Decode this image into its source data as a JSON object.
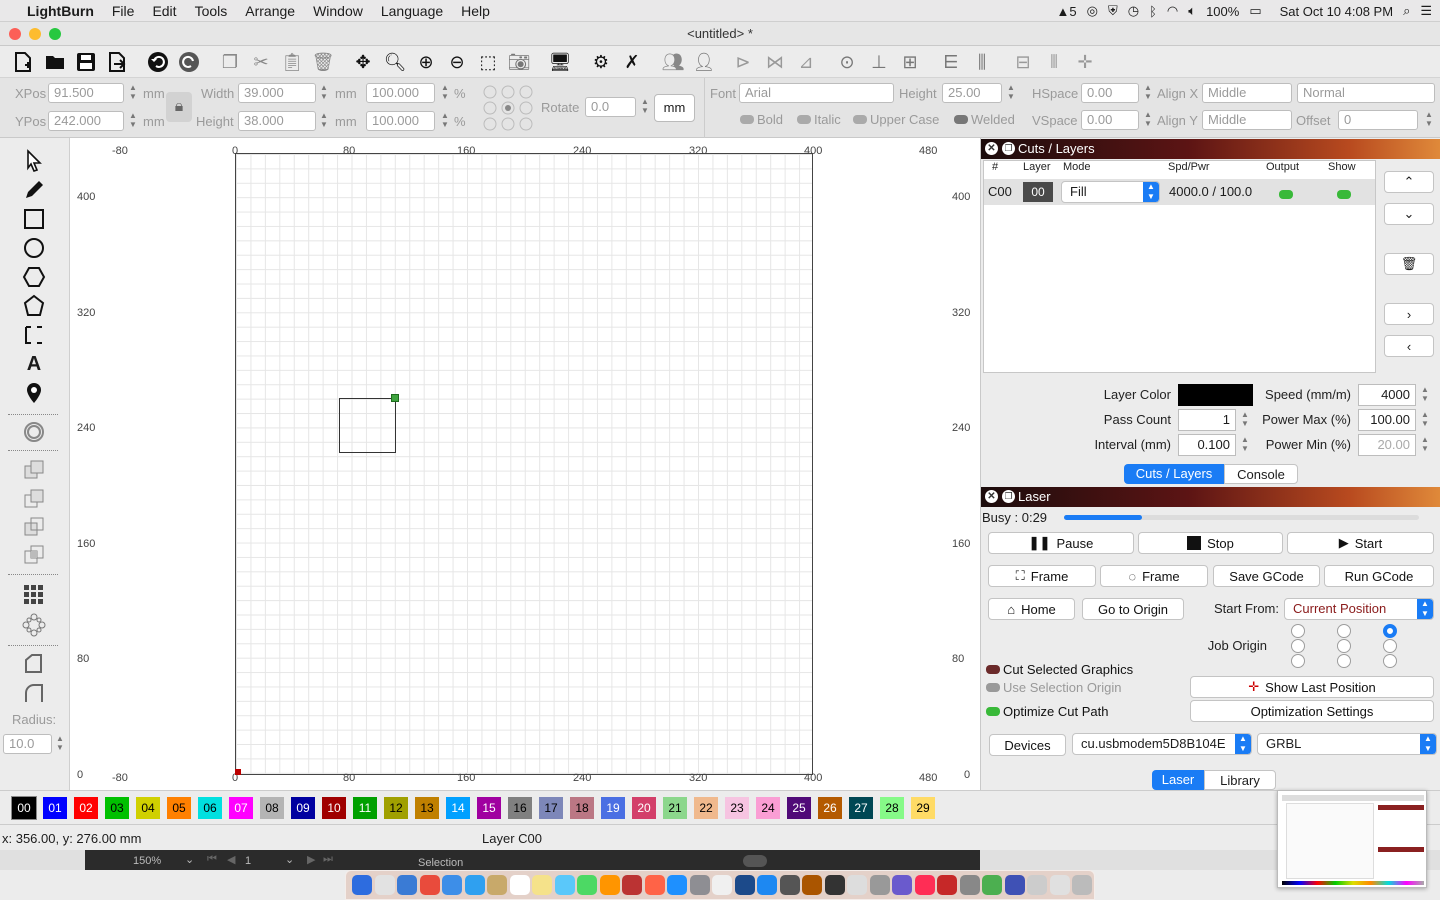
{
  "menubar": {
    "app": "LightBurn",
    "items": [
      "File",
      "Edit",
      "Tools",
      "Arrange",
      "Window",
      "Language",
      "Help"
    ],
    "right_app_count": "5",
    "battery": "100%",
    "datetime": "Sat Oct 10  4:08 PM"
  },
  "window": {
    "title": "<untitled> *"
  },
  "props": {
    "xpos_label": "XPos",
    "xpos": "91.500",
    "ypos_label": "YPos",
    "ypos": "242.000",
    "unit_mm": "mm",
    "width_label": "Width",
    "width": "39.000",
    "height_label": "Height",
    "height": "38.000",
    "scale_w": "100.000",
    "scale_h": "100.000",
    "percent": "%",
    "rotate_label": "Rotate",
    "rotate": "0.0",
    "unit_button": "mm",
    "font_label": "Font",
    "font": "Arial",
    "fheight_label": "Height",
    "fheight": "25.00",
    "hspace_label": "HSpace",
    "hspace": "0.00",
    "vspace_label": "VSpace",
    "vspace": "0.00",
    "alignx_label": "Align X",
    "alignx": "Middle",
    "aligny_label": "Align Y",
    "aligny": "Middle",
    "style": "Normal",
    "offset_label": "Offset",
    "offset": "0",
    "bold": "Bold",
    "italic": "Italic",
    "upper": "Upper Case",
    "welded": "Welded"
  },
  "left": {
    "radius_label": "Radius:",
    "radius": "10.0"
  },
  "ruler": {
    "top": [
      "-80",
      "0",
      "80",
      "160",
      "240",
      "320",
      "400",
      "480"
    ],
    "bottom": [
      "-80",
      "0",
      "80",
      "160",
      "240",
      "320",
      "400",
      "480"
    ],
    "left": [
      "400",
      "320",
      "240",
      "160",
      "80",
      "0"
    ],
    "right": [
      "400",
      "320",
      "240",
      "160",
      "80",
      "0"
    ]
  },
  "cuts": {
    "title": "Cuts / Layers",
    "headers": [
      "#",
      "Layer",
      "Mode",
      "Spd/Pwr",
      "Output",
      "Show"
    ],
    "row": {
      "num": "C00",
      "layer": "00",
      "mode": "Fill",
      "spdpwr": "4000.0 / 100.0"
    },
    "layer_color_label": "Layer Color",
    "pass_count_label": "Pass Count",
    "pass_count": "1",
    "interval_label": "Interval (mm)",
    "interval": "0.100",
    "speed_label": "Speed (mm/m)",
    "speed": "4000",
    "power_max_label": "Power Max (%)",
    "power_max": "100.00",
    "power_min_label": "Power Min (%)",
    "power_min": "20.00",
    "tabs": [
      "Cuts / Layers",
      "Console"
    ]
  },
  "laser": {
    "title": "Laser",
    "busy": "Busy : 0:29",
    "progress_fraction": 0.22,
    "pause": "Pause",
    "stop": "Stop",
    "start": "Start",
    "frame1": "Frame",
    "frame2": "Frame",
    "save_gcode": "Save GCode",
    "run_gcode": "Run GCode",
    "home": "Home",
    "go_origin": "Go to Origin",
    "start_from_label": "Start From:",
    "start_from": "Current Position",
    "job_origin_label": "Job Origin",
    "cut_selected": "Cut Selected Graphics",
    "use_selection_origin": "Use Selection Origin",
    "optimize_cut": "Optimize Cut Path",
    "show_last": "Show Last Position",
    "opt_settings": "Optimization Settings",
    "devices": "Devices",
    "port": "cu.usbmodem5D8B104E",
    "controller": "GRBL",
    "tabs": [
      "Laser",
      "Library"
    ]
  },
  "palette": [
    {
      "label": "00",
      "color": "#000000",
      "fg": "#ffffff"
    },
    {
      "label": "01",
      "color": "#0000ff",
      "fg": "#ffffff"
    },
    {
      "label": "02",
      "color": "#ff0000",
      "fg": "#ffffff"
    },
    {
      "label": "03",
      "color": "#00c000",
      "fg": "#000000"
    },
    {
      "label": "04",
      "color": "#d0d000",
      "fg": "#000000"
    },
    {
      "label": "05",
      "color": "#ff8000",
      "fg": "#000000"
    },
    {
      "label": "06",
      "color": "#00e0e0",
      "fg": "#000000"
    },
    {
      "label": "07",
      "color": "#ff00ff",
      "fg": "#ffffff"
    },
    {
      "label": "08",
      "color": "#b4b4b4",
      "fg": "#000000"
    },
    {
      "label": "09",
      "color": "#0000a0",
      "fg": "#ffffff"
    },
    {
      "label": "10",
      "color": "#a00000",
      "fg": "#ffffff"
    },
    {
      "label": "11",
      "color": "#00a000",
      "fg": "#ffffff"
    },
    {
      "label": "12",
      "color": "#a0a000",
      "fg": "#000000"
    },
    {
      "label": "13",
      "color": "#c08000",
      "fg": "#000000"
    },
    {
      "label": "14",
      "color": "#00a0ff",
      "fg": "#ffffff"
    },
    {
      "label": "15",
      "color": "#a000a0",
      "fg": "#ffffff"
    },
    {
      "label": "16",
      "color": "#808080",
      "fg": "#000000"
    },
    {
      "label": "17",
      "color": "#7d87b9",
      "fg": "#000000"
    },
    {
      "label": "18",
      "color": "#bb7784",
      "fg": "#000000"
    },
    {
      "label": "19",
      "color": "#4a6fe3",
      "fg": "#ffffff"
    },
    {
      "label": "20",
      "color": "#d33f6a",
      "fg": "#ffffff"
    },
    {
      "label": "21",
      "color": "#8cd78c",
      "fg": "#000000"
    },
    {
      "label": "22",
      "color": "#f0b98d",
      "fg": "#000000"
    },
    {
      "label": "23",
      "color": "#f6c4e1",
      "fg": "#000000"
    },
    {
      "label": "24",
      "color": "#fa9ed4",
      "fg": "#000000"
    },
    {
      "label": "25",
      "color": "#500a78",
      "fg": "#ffffff"
    },
    {
      "label": "26",
      "color": "#b45a00",
      "fg": "#ffffff"
    },
    {
      "label": "27",
      "color": "#004754",
      "fg": "#ffffff"
    },
    {
      "label": "28",
      "color": "#86fa88",
      "fg": "#000000"
    },
    {
      "label": "29",
      "color": "#ffdb66",
      "fg": "#000000"
    }
  ],
  "status": {
    "coords": "x: 356.00, y: 276.00 mm",
    "layer": "Layer C00"
  },
  "bottom_bar": {
    "zoom": "150%",
    "page": "1",
    "mode": "Selection"
  }
}
